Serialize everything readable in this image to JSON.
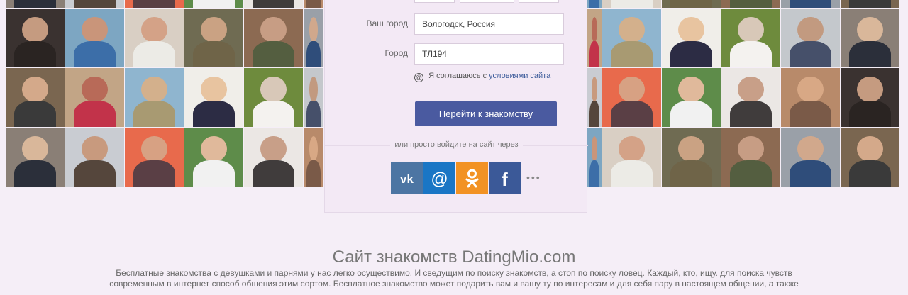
{
  "form": {
    "city_label": "Ваш город",
    "city_value": "Вологодск, Россия",
    "captcha_label": "Город",
    "captcha_value": "ТЛ194",
    "agree_prefix": "Я соглашаюсь с",
    "agree_link": "условиями сайта",
    "submit_label": "Перейти к знакомству",
    "or_text": "или просто войдите на сайт через",
    "more_label": "•••"
  },
  "social": [
    {
      "name": "vk",
      "label": "VK",
      "color": "#4c75a3"
    },
    {
      "name": "mail",
      "label": "@",
      "color": "#1a76c5"
    },
    {
      "name": "odnoklassniki",
      "label": "OK",
      "color": "#f29223"
    },
    {
      "name": "facebook",
      "label": "f",
      "color": "#3b5998"
    }
  ],
  "footer": {
    "title": "Сайт знакомств DatingMio.com",
    "description": "Бесплатные знакомства с девушками и парнями у нас легко осуществимо. И сведущим по поиску знакомств, а стоп по поиску ловец. Каждый, кто, ищу. для поиска чувств современным в интернет способ общения этим сортом. Бесплатное знакомство может подарить вам и вашу ту по интересам и для себя пару в настоящем общении, а также"
  }
}
